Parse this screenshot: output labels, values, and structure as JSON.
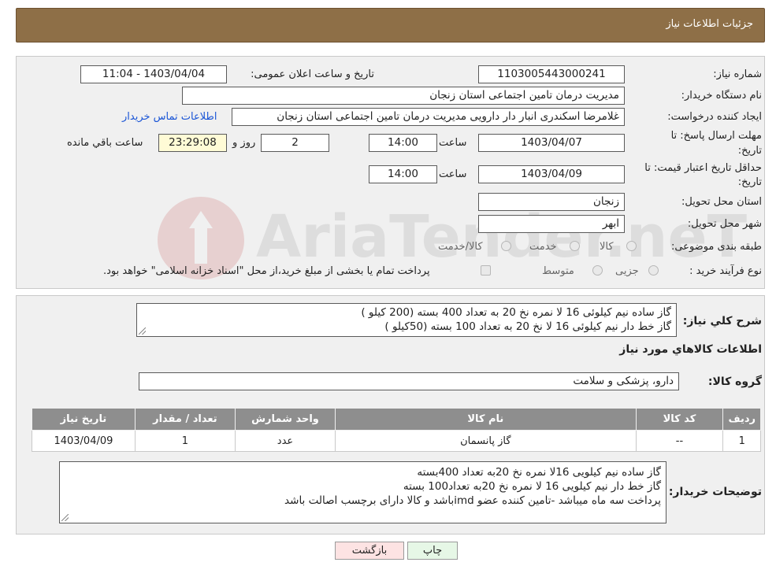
{
  "header": {
    "title": "جزئیات اطلاعات نیاز"
  },
  "form": {
    "need_number_label": "شماره نیاز:",
    "need_number": "1103005443000241",
    "announce_label": "تاریخ و ساعت اعلان عمومی:",
    "announce_value": "1403/04/04 - 11:04",
    "buyer_org_label": "نام دستگاه خریدار:",
    "buyer_org": "مدیریت درمان تامین اجتماعی استان زنجان",
    "creator_label": "ایجاد کننده درخواست:",
    "creator": "غلامرضا  اسکندری انبار دار دارویی مدیریت درمان تامین اجتماعی استان زنجان",
    "contact_link": "اطلاعات تماس خریدار",
    "deadline_label_line1": "مهلت ارسال پاسخ: تا",
    "deadline_label_line2": "تاریخ:",
    "deadline_date": "1403/04/07",
    "time_label": "ساعت",
    "deadline_time": "14:00",
    "days_value": "2",
    "days_label": "روز و",
    "remaining_value": "23:29:08",
    "remaining_label": "ساعت باقي مانده",
    "validity_label_line1": "حداقل تاریخ اعتبار قیمت: تا",
    "validity_label_line2": "تاریخ:",
    "validity_date": "1403/04/09",
    "validity_time": "14:00",
    "province_label": "استان محل تحویل:",
    "province": "زنجان",
    "city_label": "شهر محل تحویل:",
    "city": "ابهر",
    "category_label": "طبقه بندی موضوعی:",
    "category_options": [
      "کالا",
      "خدمت",
      "کالا/خدمت"
    ],
    "process_label": "نوع فرآیند خرید :",
    "process_options": [
      "جزیی",
      "متوسط"
    ],
    "process_note": "پرداخت تمام یا بخشی از مبلغ خرید،از محل \"اسناد خزانه اسلامی\" خواهد بود."
  },
  "description": {
    "label": "شرح کلي نياز:",
    "lines": [
      "گاز ساده نیم کیلوئی 16 لا نمره نخ 20 به تعداد 400 بسته (200 کیلو )",
      "گاز خط دار نیم کیلوئی 16 لا نخ 20 به تعداد 100 بسته (50کیلو )"
    ]
  },
  "goods": {
    "section_title": "اطلاعات کالاهاي مورد نياز",
    "group_label": "گروه کالا:",
    "group_value": "دارو، پزشکی و سلامت",
    "table": {
      "headers": [
        "رديف",
        "کد کالا",
        "نام کالا",
        "واحد شمارش",
        "تعداد / مقدار",
        "تاريخ نياز"
      ],
      "rows": [
        [
          "1",
          "--",
          "گاز پانسمان",
          "عدد",
          "1",
          "1403/04/09"
        ]
      ]
    }
  },
  "buyer_notes": {
    "label": "توضیحات خریدار:",
    "lines": [
      "گاز ساده نیم کیلویی 16لا نمره نخ 20به تعداد 400بسته",
      "گاز خط دار نیم کیلویی 16 لا نمره نخ 20به تعداد100 بسته",
      "پرداخت سه ماه میباشد -تامین کننده عضو imdباشد و کالا دارای برچسب اصالت باشد"
    ]
  },
  "buttons": {
    "print": "چاپ",
    "back": "بازگشت"
  },
  "watermark": {
    "text": "AriaTender.neT"
  },
  "colors": {
    "header_bg": "#8e6f47",
    "panel_bg": "#f0f0f0",
    "table_header_bg": "#8e8e8e",
    "link": "#1a55d6",
    "remaining_bg": "#fffbd6",
    "back_button_bg": "#fde3e3",
    "print_button_bg": "#e6f7e6"
  }
}
